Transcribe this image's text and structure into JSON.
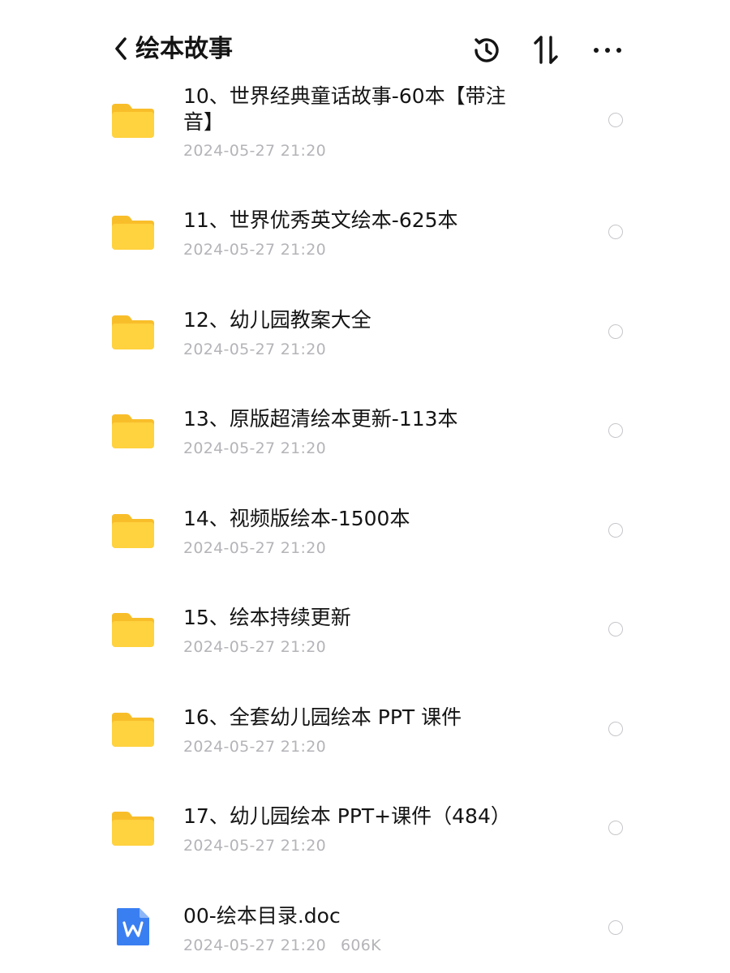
{
  "header": {
    "title": "绘本故事",
    "back_icon": "chevron-left-icon",
    "actions": [
      "history-icon",
      "sort-icon",
      "more-icon"
    ]
  },
  "items": [
    {
      "type": "folder",
      "name": "10、世界经典童话故事-60本【带注音】",
      "date": "2024-05-27 21:20",
      "size": ""
    },
    {
      "type": "folder",
      "name": "11、世界优秀英文绘本-625本",
      "date": "2024-05-27 21:20",
      "size": ""
    },
    {
      "type": "folder",
      "name": "12、幼儿园教案大全",
      "date": "2024-05-27 21:20",
      "size": ""
    },
    {
      "type": "folder",
      "name": "13、原版超清绘本更新-113本",
      "date": "2024-05-27 21:20",
      "size": ""
    },
    {
      "type": "folder",
      "name": "14、视频版绘本-1500本",
      "date": "2024-05-27 21:20",
      "size": ""
    },
    {
      "type": "folder",
      "name": "15、绘本持续更新",
      "date": "2024-05-27 21:20",
      "size": ""
    },
    {
      "type": "folder",
      "name": "16、全套幼儿园绘本 PPT 课件",
      "date": "2024-05-27 21:20",
      "size": ""
    },
    {
      "type": "folder",
      "name": "17、幼儿园绘本 PPT+课件（484）",
      "date": "2024-05-27 21:20",
      "size": ""
    },
    {
      "type": "doc",
      "name": "00-绘本目录.doc",
      "date": "2024-05-27 21:20",
      "size": "606K"
    }
  ],
  "colors": {
    "folder": "#FFD23F",
    "folder_back": "#F8BE2A",
    "doc": "#3A7FF2",
    "meta_text": "#B4B4B9",
    "circle": "#C6C6CB"
  }
}
